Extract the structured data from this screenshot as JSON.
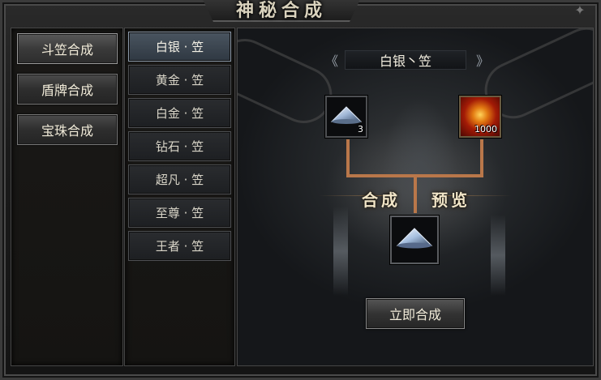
{
  "window": {
    "title": "神秘合成"
  },
  "categories": [
    {
      "label": "斗笠合成"
    },
    {
      "label": "盾牌合成"
    },
    {
      "label": "宝珠合成"
    }
  ],
  "items": [
    {
      "label": "白银 · 笠"
    },
    {
      "label": "黄金 · 笠"
    },
    {
      "label": "白金 · 笠"
    },
    {
      "label": "钻石 · 笠"
    },
    {
      "label": "超凡 · 笠"
    },
    {
      "label": "至尊 · 笠"
    },
    {
      "label": "王者 · 笠"
    }
  ],
  "recipe": {
    "name": "白银丶笠",
    "prev_arrow": "《",
    "next_arrow": "》",
    "material_count": "3",
    "gold_count": "1000",
    "label_left": "合成",
    "label_right": "预览",
    "craft_label": "立即合成"
  },
  "colors": {
    "connector": "#b9774a",
    "active_item": "#3e4852"
  }
}
